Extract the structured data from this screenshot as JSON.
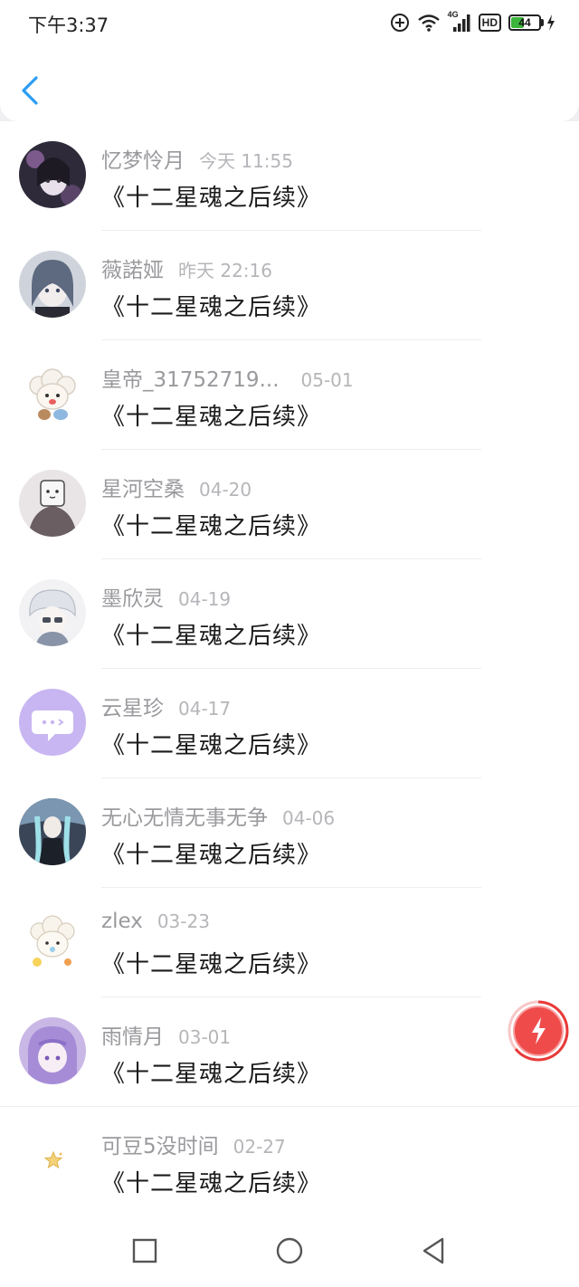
{
  "status_bar": {
    "time": "下午3:37",
    "network": "4G",
    "hd": "HD",
    "battery": "44"
  },
  "items": [
    {
      "name": "忆梦怜月",
      "time": "今天 11:55",
      "title": "《十二星魂之后续》"
    },
    {
      "name": "薇諾娅",
      "time": "昨天 22:16",
      "title": "《十二星魂之后续》"
    },
    {
      "name": "皇帝_31752719...",
      "time": "05-01",
      "title": "《十二星魂之后续》"
    },
    {
      "name": "星河空桑",
      "time": "04-20",
      "title": "《十二星魂之后续》"
    },
    {
      "name": "墨欣灵",
      "time": "04-19",
      "title": "《十二星魂之后续》"
    },
    {
      "name": "云星珍",
      "time": "04-17",
      "title": "《十二星魂之后续》"
    },
    {
      "name": "无心无情无事无争",
      "time": "04-06",
      "title": "《十二星魂之后续》"
    },
    {
      "name": "zlex",
      "time": "03-23",
      "title": "《十二星魂之后续》"
    },
    {
      "name": "雨情月",
      "time": "03-01",
      "title": "《十二星魂之后续》"
    },
    {
      "name": "可豆5没时间",
      "time": "02-27",
      "title": "《十二星魂之后续》"
    }
  ],
  "icons": {
    "back": "chevron-left-icon",
    "float": "lightning-icon",
    "nav_recents": "square-icon",
    "nav_home": "circle-icon",
    "nav_back": "triangle-back-icon"
  },
  "colors": {
    "accent": "#2a9df4",
    "float_button": "#ef4b4b"
  }
}
